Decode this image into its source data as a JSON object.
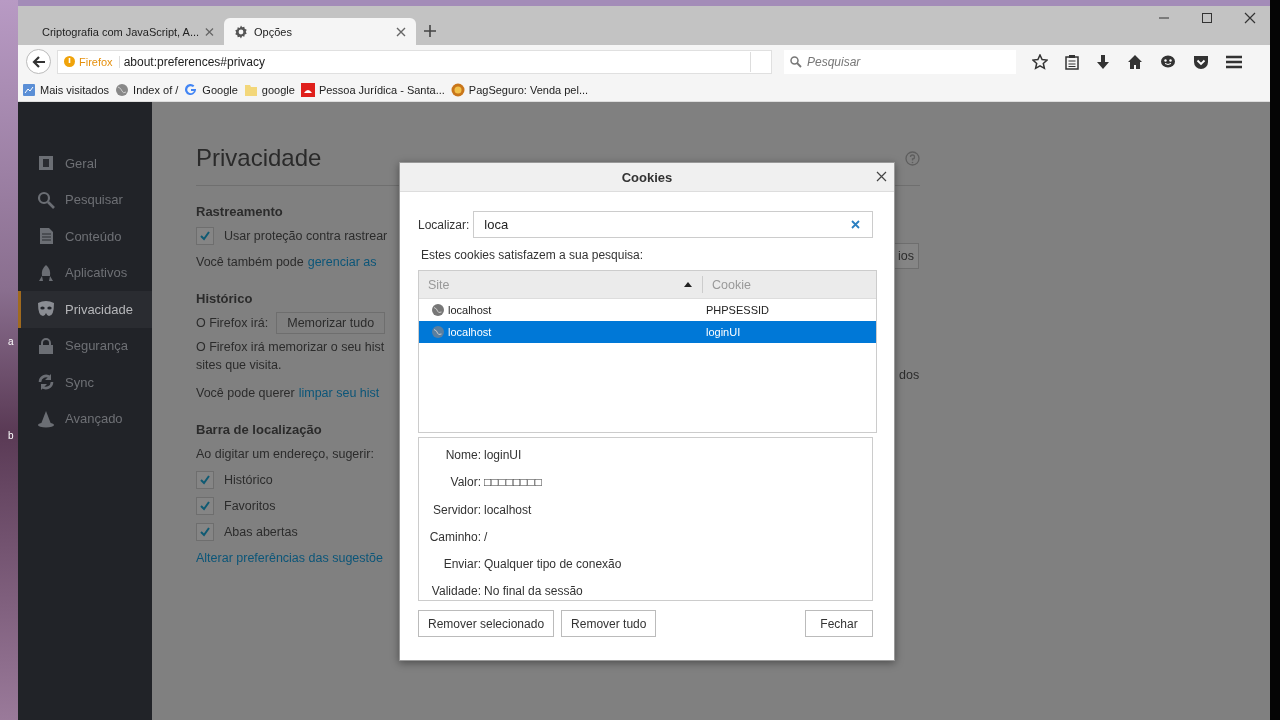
{
  "desktop": {
    "labels": [
      "a",
      "b"
    ]
  },
  "tabs": [
    {
      "title": "Criptografia com JavaScript, A...",
      "selected": false
    },
    {
      "title": "Opções",
      "selected": true
    }
  ],
  "navbar": {
    "identity": "Firefox",
    "url": "about:preferences#privacy",
    "search_placeholder": "Pesquisar"
  },
  "bookmarks": [
    {
      "label": "Mais visitados"
    },
    {
      "label": "Index of /"
    },
    {
      "label": "Google"
    },
    {
      "label": "google"
    },
    {
      "label": "Pessoa Jurídica - Santa..."
    },
    {
      "label": "PagSeguro: Venda pel..."
    }
  ],
  "sidebar": [
    {
      "label": "Geral",
      "selected": false
    },
    {
      "label": "Pesquisar",
      "selected": false
    },
    {
      "label": "Conteúdo",
      "selected": false
    },
    {
      "label": "Aplicativos",
      "selected": false
    },
    {
      "label": "Privacidade",
      "selected": true
    },
    {
      "label": "Segurança",
      "selected": false
    },
    {
      "label": "Sync",
      "selected": false
    },
    {
      "label": "Avançado",
      "selected": false
    }
  ],
  "page": {
    "title": "Privacidade",
    "tracking": {
      "heading": "Rastreamento",
      "checkbox": {
        "label": "Usar proteção contra rastrear",
        "checked": true
      },
      "text": "Você também pode",
      "link": "gerenciar as",
      "button_fragment": "ios"
    },
    "history": {
      "heading": "Histórico",
      "label": "O Firefox irá:",
      "select_value": "Memorizar tudo",
      "line1": "O Firefox irá memorizar o seu hist",
      "line1_tail": "dos",
      "line2": "sites que visita.",
      "clear_text": "Você pode querer",
      "clear_link": "limpar seu hist"
    },
    "location_bar": {
      "heading": "Barra de localização",
      "prompt": "Ao digitar um endereço, sugerir:",
      "options": [
        {
          "label": "Histórico",
          "checked": true
        },
        {
          "label": "Favoritos",
          "checked": true
        },
        {
          "label": "Abas abertas",
          "checked": true
        }
      ],
      "link": "Alterar preferências das sugestõe"
    }
  },
  "dialog": {
    "title": "Cookies",
    "search_label": "Localizar:",
    "search_value": "loca",
    "hint": "Estes cookies satisfazem a sua pesquisa:",
    "columns": [
      {
        "label": "Site",
        "sorted": true
      },
      {
        "label": "Cookie",
        "sorted": false
      }
    ],
    "rows": [
      {
        "site": "localhost",
        "cookie": "PHPSESSID",
        "selected": false
      },
      {
        "site": "localhost",
        "cookie": "loginUI",
        "selected": true
      }
    ],
    "details": [
      {
        "label": "Nome:",
        "value": "loginUI"
      },
      {
        "label": "Valor:",
        "value": "□□□□□□□□"
      },
      {
        "label": "Servidor:",
        "value": "localhost"
      },
      {
        "label": "Caminho:",
        "value": "/"
      },
      {
        "label": "Enviar:",
        "value": "Qualquer tipo de conexão"
      },
      {
        "label": "Validade:",
        "value": "No final da sessão"
      }
    ],
    "buttons": [
      {
        "label": "Remover selecionado"
      },
      {
        "label": "Remover tudo"
      },
      {
        "label": "Fechar"
      }
    ]
  }
}
